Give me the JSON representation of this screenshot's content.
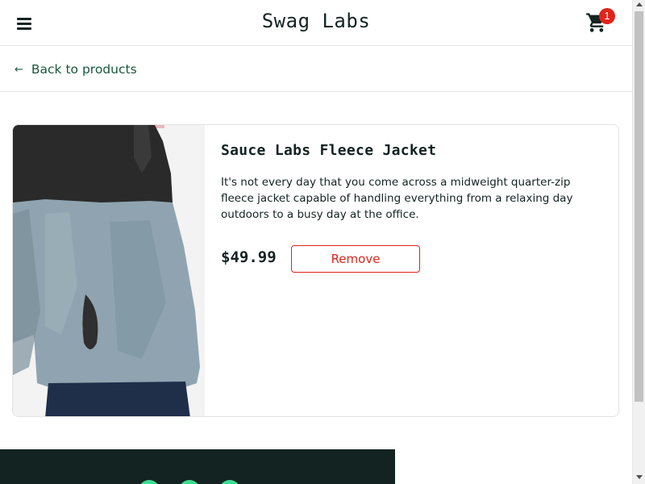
{
  "header": {
    "app_title": "Swag Labs",
    "menu_icon": "hamburger-menu-icon",
    "cart_icon": "shopping-cart-icon",
    "cart_count": "1",
    "badge_color": "#e2231a"
  },
  "sub_header": {
    "back_label": "Back to products",
    "back_icon": "arrow-left-icon",
    "link_color": "#18583a"
  },
  "product": {
    "name": "Sauce Labs Fleece Jacket",
    "description": "It's not every day that you come across a midweight quarter-zip fleece jacket capable of handling everything from a relaxing day outdoors to a busy day at the office.",
    "price": "$49.99",
    "remove_label": "Remove",
    "image_subject": "person wearing gray fleece jacket with black top panel"
  },
  "footer": {
    "background": "#132322",
    "social_icons": [
      "twitter-icon",
      "facebook-icon",
      "linkedin-icon"
    ],
    "social_color": "#3ddc91"
  }
}
